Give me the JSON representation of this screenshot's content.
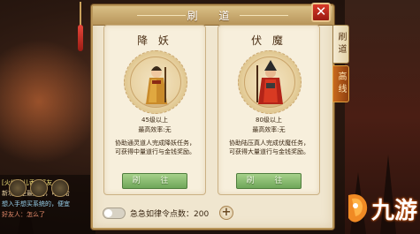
{
  "window": {
    "title": "刷 道",
    "close_label": "✕"
  },
  "tabs": [
    {
      "label": "刷道",
      "active": true
    },
    {
      "label": "高线",
      "active": false
    }
  ],
  "cards": [
    {
      "title": "降 妖",
      "level": "45级以上",
      "efficiency": "最高效率:无",
      "description": "协助通灵道人完成降妖任务，可获得中量道行与金钱奖励。",
      "button": "刷 往"
    },
    {
      "title": "伏 魔",
      "level": "80级以上",
      "efficiency": "最高效率:无",
      "description": "协助陆压真人完成伏魔任务，可获得大量道行与金钱奖励。",
      "button": "刷 往"
    }
  ],
  "bottom": {
    "order_text": "急急如律令点数：200",
    "plus_label": "+"
  },
  "chat": {
    "lines": [
      {
        "text": "[火焰花儿香][好友",
        "color": "#f2e27a"
      },
      {
        "text": "新功法是最好的，可以给",
        "color": "#e9d3a4"
      },
      {
        "text": "想入手想买系统的，便宜",
        "color": "#9bd4f0"
      },
      {
        "text": "好友人：怎么了",
        "color": "#e38a6a"
      }
    ]
  },
  "watermark": {
    "text": "九游"
  },
  "colors": {
    "panel_bg": "#f0e6cf",
    "accent_gold": "#b89457",
    "button_green": "#6fa659",
    "close_red": "#d93a2a",
    "tab_orange": "#c86a1e"
  }
}
